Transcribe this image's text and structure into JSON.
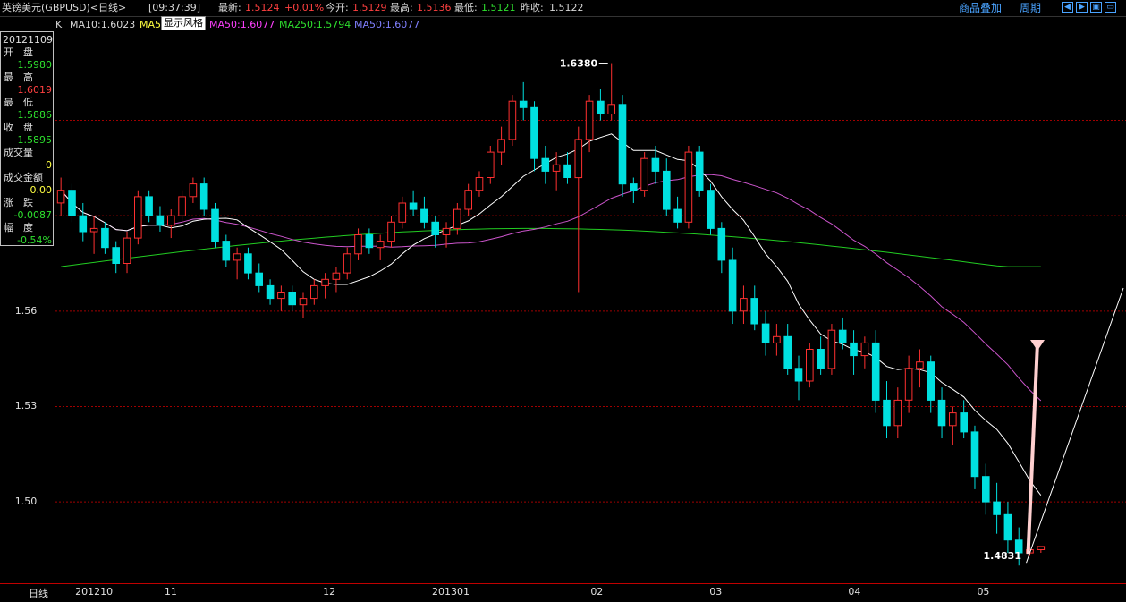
{
  "topbar": {
    "instrument": "英镑美元(GBPUSD)<日线>",
    "time": "[09:37:39]",
    "latest_label": "最新:",
    "latest_value": "1.5124",
    "change": "+0.01%",
    "open_label": "今开:",
    "open_value": "1.5129",
    "high_label": "最高:",
    "high_value": "1.5136",
    "low_label": "最低:",
    "low_value": "1.5121",
    "prevclose_label": "昨收:",
    "prevclose_value": "1.5122",
    "link_overlay": "商品叠加",
    "link_period": "周期"
  },
  "legend": {
    "k": "K",
    "ma10": "MA10:1.6023",
    "ma5": "MA5",
    "style_button": "显示风格",
    "ma50a": "MA50:1.6077",
    "ma250": "MA250:1.5794",
    "ma50b": "MA50:1.6077"
  },
  "infobox": {
    "date": "20121109",
    "open_label": "开　盘",
    "open_value": "1.5980",
    "high_label": "最　高",
    "high_value": "1.6019",
    "low_label": "最　低",
    "low_value": "1.5886",
    "close_label": "收　盘",
    "close_value": "1.5895",
    "volume_label": "成交量",
    "volume_value": "0",
    "amount_label": "成交金额",
    "amount_value": "0.00",
    "change_label": "涨　跌",
    "change_value": "-0.0087",
    "range_label": "幅　度",
    "range_value": "-0.54%"
  },
  "colors": {
    "up": "#ff3030",
    "down": "#00e0e0",
    "ma10": "#ffffff",
    "ma50": "#cc55cc",
    "ma250": "#22cc22",
    "grid": "#a00000"
  },
  "chart_data": {
    "type": "candlestick",
    "ylim": [
      1.475,
      1.648
    ],
    "yticks": [
      1.5,
      1.53,
      1.56
    ],
    "ytick_labels": [
      "1.50",
      "1.53",
      "1.56"
    ],
    "xtick_labels": [
      "日线",
      "201210",
      "11",
      "12",
      "201301",
      "02",
      "03",
      "04",
      "05"
    ],
    "annotations": [
      {
        "text": "1.6380",
        "value": 1.638
      },
      {
        "text": "1.4831",
        "value": 1.4831
      }
    ],
    "candles": [
      [
        1.594,
        1.602,
        1.59,
        1.598
      ],
      [
        1.598,
        1.6,
        1.588,
        1.59
      ],
      [
        1.59,
        1.594,
        1.582,
        1.585
      ],
      [
        1.585,
        1.59,
        1.578,
        1.586
      ],
      [
        1.586,
        1.588,
        1.578,
        1.58
      ],
      [
        1.58,
        1.582,
        1.572,
        1.575
      ],
      [
        1.575,
        1.585,
        1.572,
        1.583
      ],
      [
        1.583,
        1.598,
        1.581,
        1.596
      ],
      [
        1.596,
        1.598,
        1.588,
        1.59
      ],
      [
        1.59,
        1.593,
        1.585,
        1.587
      ],
      [
        1.587,
        1.592,
        1.583,
        1.59
      ],
      [
        1.59,
        1.598,
        1.588,
        1.596
      ],
      [
        1.596,
        1.602,
        1.594,
        1.6
      ],
      [
        1.6,
        1.602,
        1.59,
        1.592
      ],
      [
        1.592,
        1.594,
        1.58,
        1.582
      ],
      [
        1.582,
        1.584,
        1.574,
        1.576
      ],
      [
        1.576,
        1.58,
        1.57,
        1.578
      ],
      [
        1.578,
        1.58,
        1.57,
        1.572
      ],
      [
        1.572,
        1.575,
        1.566,
        1.568
      ],
      [
        1.568,
        1.57,
        1.562,
        1.564
      ],
      [
        1.564,
        1.568,
        1.56,
        1.566
      ],
      [
        1.566,
        1.568,
        1.56,
        1.562
      ],
      [
        1.562,
        1.566,
        1.558,
        1.564
      ],
      [
        1.564,
        1.57,
        1.562,
        1.568
      ],
      [
        1.568,
        1.572,
        1.564,
        1.57
      ],
      [
        1.57,
        1.574,
        1.566,
        1.572
      ],
      [
        1.572,
        1.58,
        1.57,
        1.578
      ],
      [
        1.578,
        1.586,
        1.576,
        1.584
      ],
      [
        1.584,
        1.586,
        1.578,
        1.58
      ],
      [
        1.58,
        1.584,
        1.576,
        1.582
      ],
      [
        1.582,
        1.59,
        1.58,
        1.588
      ],
      [
        1.588,
        1.596,
        1.586,
        1.594
      ],
      [
        1.594,
        1.598,
        1.59,
        1.592
      ],
      [
        1.592,
        1.596,
        1.586,
        1.588
      ],
      [
        1.588,
        1.59,
        1.58,
        1.584
      ],
      [
        1.584,
        1.588,
        1.58,
        1.586
      ],
      [
        1.586,
        1.594,
        1.584,
        1.592
      ],
      [
        1.592,
        1.6,
        1.59,
        1.598
      ],
      [
        1.598,
        1.604,
        1.596,
        1.602
      ],
      [
        1.602,
        1.612,
        1.6,
        1.61
      ],
      [
        1.61,
        1.618,
        1.606,
        1.614
      ],
      [
        1.614,
        1.628,
        1.612,
        1.626
      ],
      [
        1.626,
        1.632,
        1.62,
        1.624
      ],
      [
        1.624,
        1.626,
        1.604,
        1.608
      ],
      [
        1.608,
        1.612,
        1.6,
        1.604
      ],
      [
        1.604,
        1.61,
        1.598,
        1.606
      ],
      [
        1.606,
        1.61,
        1.6,
        1.602
      ],
      [
        1.602,
        1.618,
        1.566,
        1.614
      ],
      [
        1.614,
        1.628,
        1.61,
        1.626
      ],
      [
        1.626,
        1.63,
        1.62,
        1.622
      ],
      [
        1.622,
        1.638,
        1.62,
        1.625
      ],
      [
        1.625,
        1.628,
        1.596,
        1.6
      ],
      [
        1.6,
        1.602,
        1.594,
        1.598
      ],
      [
        1.598,
        1.61,
        1.596,
        1.608
      ],
      [
        1.608,
        1.612,
        1.6,
        1.604
      ],
      [
        1.604,
        1.608,
        1.59,
        1.592
      ],
      [
        1.592,
        1.596,
        1.586,
        1.588
      ],
      [
        1.588,
        1.612,
        1.586,
        1.61
      ],
      [
        1.61,
        1.612,
        1.596,
        1.598
      ],
      [
        1.598,
        1.6,
        1.584,
        1.586
      ],
      [
        1.586,
        1.588,
        1.572,
        1.576
      ],
      [
        1.576,
        1.58,
        1.556,
        1.56
      ],
      [
        1.56,
        1.568,
        1.556,
        1.564
      ],
      [
        1.564,
        1.568,
        1.554,
        1.556
      ],
      [
        1.556,
        1.56,
        1.546,
        1.55
      ],
      [
        1.55,
        1.556,
        1.546,
        1.552
      ],
      [
        1.552,
        1.556,
        1.54,
        1.542
      ],
      [
        1.542,
        1.546,
        1.532,
        1.538
      ],
      [
        1.538,
        1.55,
        1.536,
        1.548
      ],
      [
        1.548,
        1.552,
        1.54,
        1.542
      ],
      [
        1.542,
        1.556,
        1.54,
        1.554
      ],
      [
        1.554,
        1.558,
        1.548,
        1.55
      ],
      [
        1.55,
        1.554,
        1.54,
        1.546
      ],
      [
        1.546,
        1.552,
        1.542,
        1.55
      ],
      [
        1.55,
        1.554,
        1.528,
        1.532
      ],
      [
        1.532,
        1.538,
        1.52,
        1.524
      ],
      [
        1.524,
        1.536,
        1.52,
        1.532
      ],
      [
        1.532,
        1.546,
        1.528,
        1.542
      ],
      [
        1.542,
        1.548,
        1.536,
        1.544
      ],
      [
        1.544,
        1.546,
        1.528,
        1.532
      ],
      [
        1.532,
        1.536,
        1.52,
        1.524
      ],
      [
        1.524,
        1.53,
        1.518,
        1.528
      ],
      [
        1.528,
        1.532,
        1.52,
        1.522
      ],
      [
        1.522,
        1.524,
        1.504,
        1.508
      ],
      [
        1.508,
        1.512,
        1.496,
        1.5
      ],
      [
        1.5,
        1.506,
        1.49,
        1.496
      ],
      [
        1.496,
        1.5,
        1.484,
        1.488
      ],
      [
        1.488,
        1.492,
        1.48,
        1.484
      ],
      [
        1.484,
        1.486,
        1.483,
        1.485
      ],
      [
        1.485,
        1.486,
        1.484,
        1.486
      ]
    ]
  }
}
